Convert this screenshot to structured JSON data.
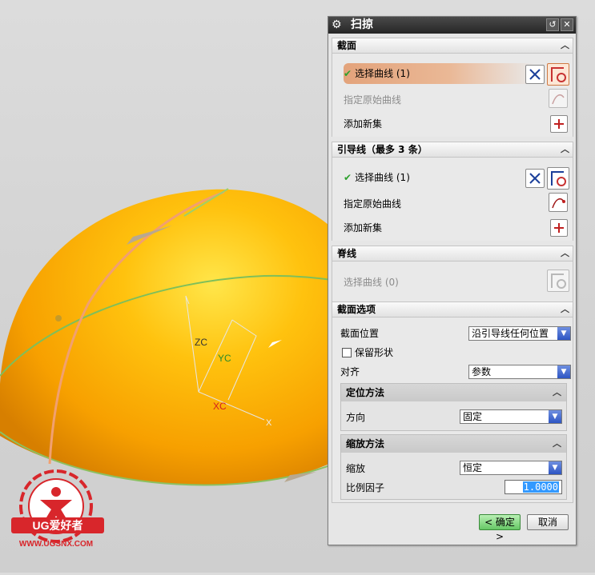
{
  "dialog": {
    "title": "扫掠",
    "section_curve": {
      "header": "截面",
      "select_curve": "选择曲线 (1)",
      "specify_original": "指定原始曲线",
      "add_new_set": "添加新集"
    },
    "section_guide": {
      "header": "引导线（最多 3 条）",
      "select_curve": "选择曲线 (1)",
      "specify_original": "指定原始曲线",
      "add_new_set": "添加新集"
    },
    "section_spine": {
      "header": "脊线",
      "select_curve": "选择曲线 (0)"
    },
    "section_options": {
      "header": "截面选项",
      "position_label": "截面位置",
      "position_value": "沿引导线任何位置",
      "preserve_shape": "保留形状",
      "preserve_shape_checked": false,
      "align_label": "对齐",
      "align_value": "参数",
      "orientation": {
        "header": "定位方法",
        "direction_label": "方向",
        "direction_value": "固定"
      },
      "scaling": {
        "header": "缩放方法",
        "scale_label": "缩放",
        "scale_value": "恒定",
        "factor_label": "比例因子",
        "factor_value": "1.0000"
      }
    },
    "ok_button": "< 确定 >",
    "cancel_button": "取消"
  },
  "viewport": {
    "axis_zc": "ZC",
    "axis_yc": "YC",
    "axis_xc": "XC",
    "axis_x": "X",
    "dome_color": "#f7a800"
  },
  "logo": {
    "brand": "UG爱好者",
    "url": "WWW.UGSNX.COM",
    "color": "#d8262b"
  },
  "icons": {
    "gear": "gear-icon",
    "reset": "reset-icon",
    "close": "close-icon",
    "collapse": "chevron-up-icon"
  }
}
